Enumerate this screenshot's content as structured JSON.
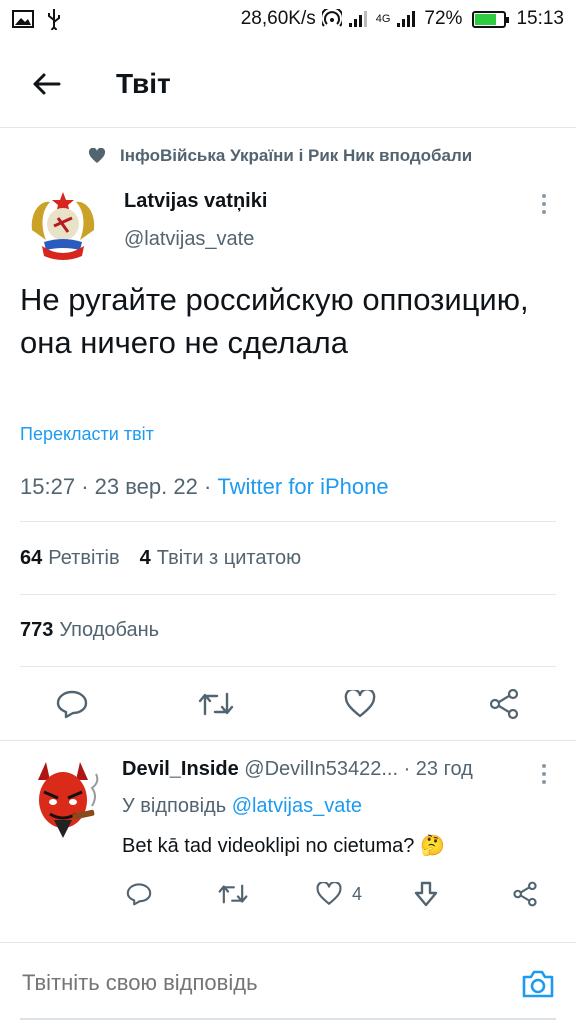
{
  "status_bar": {
    "speed": "28,60K/s",
    "network": "4G",
    "battery_percent_label": "72%",
    "battery_level": 0.72,
    "time": "15:13"
  },
  "header": {
    "title": "Твіт",
    "back_icon": "arrow-left-icon"
  },
  "social_context": {
    "icon": "heart-icon",
    "text": "ІнфоВійська України і Рик Ник вподобали"
  },
  "tweet": {
    "author_name": "Latvijas vatņiki",
    "author_handle": "@latvijas_vate",
    "text": "Не ругайте российскую оппозицию, она ничего не сделала",
    "translate_label": "Перекласти твіт",
    "time": "15:27",
    "date": "23 вер. 22",
    "separator": "·",
    "source": "Twitter for iPhone",
    "retweets_count": "64",
    "retweets_label": "Ретвітів",
    "quotes_count": "4",
    "quotes_label": "Твіти з цитатою",
    "likes_count": "773",
    "likes_label": "Уподобань"
  },
  "actions": {
    "icons": [
      "reply-icon",
      "retweet-icon",
      "like-icon",
      "share-icon"
    ]
  },
  "reply": {
    "author_name": "Devil_Inside",
    "author_handle": "@DevilIn53422...",
    "time": "· 23 год",
    "replying_prefix": "У відповідь",
    "replying_handle": "@latvijas_vate",
    "text": "Bet kā tad videoklipi no cietuma? 🤔",
    "likes_count": "4"
  },
  "composer": {
    "placeholder": "Твітніть свою відповідь",
    "camera_icon": "camera-icon"
  },
  "colors": {
    "accent": "#1d9bf0",
    "secondary_text": "#536471",
    "divider": "#e1e8ed",
    "battery": "#2ecc40"
  }
}
